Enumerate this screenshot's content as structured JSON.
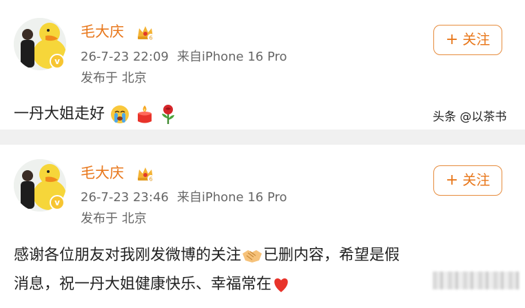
{
  "watermark": "头条 @以茶书",
  "colors": {
    "accent": "#e8771b",
    "meta": "#666666",
    "text": "#222222",
    "badge": "#f7c531"
  },
  "posts": [
    {
      "username": "毛大庆",
      "timestamp": "26-7-23 22:09",
      "source": "来自iPhone 16 Pro",
      "location": "发布于 北京",
      "follow_plus": "+",
      "follow_label": "关注",
      "badge_mark": "v",
      "text": "一丹大姐走好",
      "emojis": [
        "crying-face-icon",
        "candle-icon",
        "rose-icon"
      ]
    },
    {
      "username": "毛大庆",
      "timestamp": "26-7-23 23:46",
      "source": "来自iPhone 16 Pro",
      "location": "发布于 北京",
      "follow_plus": "+",
      "follow_label": "关注",
      "badge_mark": "v",
      "text_line1_a": "感谢各位朋友对我刚发微博的关注",
      "text_line1_b": "已删内容，希望是假",
      "text_line2": "消息，祝一丹大姐健康快乐、幸福常在",
      "emojis": [
        "handshake-icon",
        "red-heart-icon"
      ]
    }
  ]
}
